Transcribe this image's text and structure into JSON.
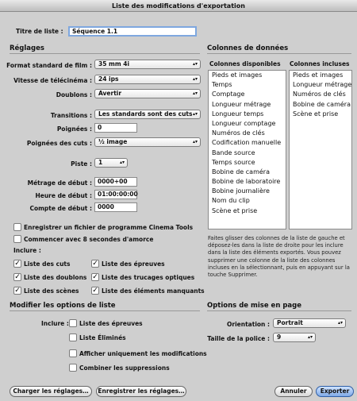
{
  "window": {
    "title": "Liste des modifications d'exportation"
  },
  "list_title": {
    "label": "Titre de liste :",
    "value": "Séquence 1.1"
  },
  "settings": {
    "heading": "Réglages",
    "film_format": {
      "label": "Format standard de film :",
      "value": "35 mm 4i"
    },
    "telecine_speed": {
      "label": "Vitesse de télécinéma :",
      "value": "24 ips"
    },
    "duplicates": {
      "label": "Doublons :",
      "value": "Avertir"
    },
    "transitions": {
      "label": "Transitions :",
      "value": "Les standards sont des cuts"
    },
    "handles": {
      "label": "Poignées :",
      "value": "0"
    },
    "cut_handles": {
      "label": "Poignées des cuts :",
      "value": "½ image"
    },
    "track": {
      "label": "Piste :",
      "value": "1"
    },
    "start_footage": {
      "label": "Métrage de début :",
      "value": "0000+00"
    },
    "start_time": {
      "label": "Heure de début :",
      "value": "01:00:00:00"
    },
    "start_count": {
      "label": "Compte de début :",
      "value": "0000"
    },
    "save_cinema_tools": {
      "label": "Enregistrer un fichier de programme Cinema Tools",
      "checked": false
    },
    "countdown": {
      "label": "Commencer avec 8 secondes d'amorce",
      "checked": false
    },
    "include_label": "Inclure :",
    "includes": [
      {
        "label": "Liste des cuts",
        "checked": true
      },
      {
        "label": "Liste des épreuves",
        "checked": true
      },
      {
        "label": "Liste des doublons",
        "checked": true
      },
      {
        "label": "Liste des trucages optiques",
        "checked": true
      },
      {
        "label": "Liste des scènes",
        "checked": true
      },
      {
        "label": "Liste des éléments manquants",
        "checked": true
      }
    ]
  },
  "modify": {
    "heading": "Modifier les options de liste",
    "include_label": "Inclure :",
    "options": [
      {
        "label": "Liste des épreuves",
        "checked": false
      },
      {
        "label": "Liste Éliminés",
        "checked": false
      },
      {
        "label": "Afficher uniquement les modifications",
        "checked": false
      },
      {
        "label": "Combiner les suppressions",
        "checked": false
      }
    ]
  },
  "columns": {
    "heading": "Colonnes de données",
    "available_heading": "Colonnes disponibles",
    "included_heading": "Colonnes incluses",
    "available": [
      "Pieds et images",
      "Temps",
      "Comptage",
      "Longueur métrage",
      "Longueur temps",
      "Longueur comptage",
      "Numéros de clés",
      "Codification manuelle",
      "Bande source",
      "Temps source",
      "Bobine de caméra",
      "Bobine de laboratoire",
      "Bobine journalière",
      "Nom du clip",
      "Scène et prise"
    ],
    "included": [
      "Pieds et images",
      "Longueur métrage",
      "Numéros de clés",
      "Bobine de caméra",
      "Scène et prise"
    ],
    "hint": "Faites glisser des colonnes de la liste de gauche et déposez-les dans la liste de droite pour les inclure dans la liste des éléments exportés. Vous pouvez supprimer une colonne de la liste des colonnes incluses en la sélectionnant, puis en appuyant sur la touche Supprimer."
  },
  "page_setup": {
    "heading": "Options de mise en page",
    "orientation": {
      "label": "Orientation :",
      "value": "Portrait"
    },
    "font_size": {
      "label": "Taille de la police :",
      "value": "9"
    }
  },
  "buttons": {
    "load": "Charger les réglages…",
    "save": "Enregistrer les réglages…",
    "cancel": "Annuler",
    "export": "Exporter"
  }
}
